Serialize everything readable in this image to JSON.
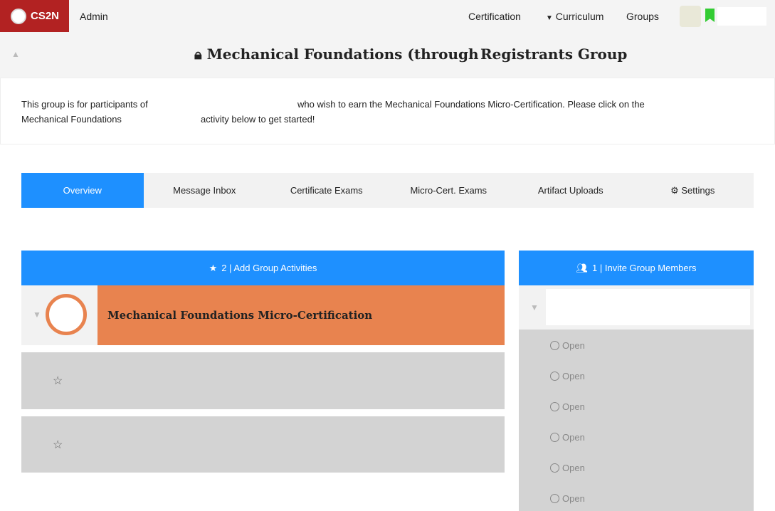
{
  "nav": {
    "brand": "CS2N",
    "admin": "Admin",
    "certification": "Certification",
    "curriculum": "Curriculum",
    "groups": "Groups"
  },
  "header": {
    "title_left": "Mechanical Foundations (through",
    "title_right": "Registrants Group"
  },
  "description": {
    "line1a": "This group is for participants of",
    "line1b": "who wish to earn the Mechanical Foundations Micro-Certification. Please click on the",
    "line2a": "Mechanical Foundations",
    "line2b": "activity below to get started!"
  },
  "tabs": [
    "Overview",
    "Message Inbox",
    "Certificate Exams",
    "Micro-Cert. Exams",
    "Artifact Uploads",
    "Settings"
  ],
  "activities": {
    "header": "2 | Add Group Activities",
    "items": [
      {
        "title": "Mechanical Foundations Micro-Certification"
      }
    ]
  },
  "members": {
    "header": "1 | Invite Group Members",
    "slots": [
      "Open",
      "Open",
      "Open",
      "Open",
      "Open",
      "Open"
    ]
  },
  "colors": {
    "brand": "#b22222",
    "accent": "#1e90ff",
    "activity": "#e8834f"
  }
}
